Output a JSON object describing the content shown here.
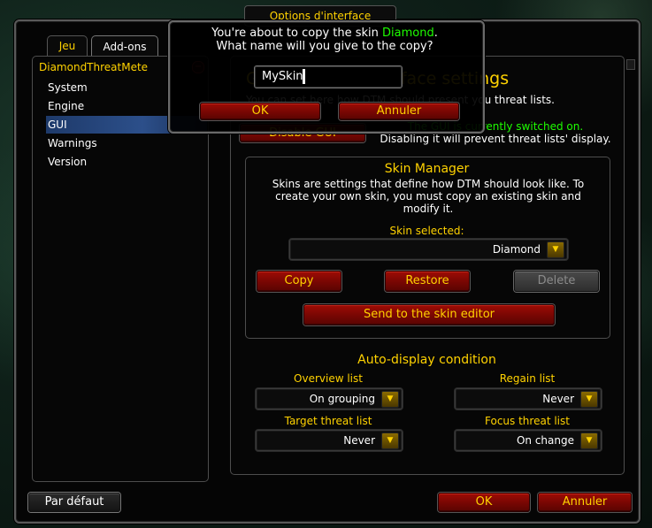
{
  "window": {
    "title": "Options d'interface",
    "tabs": [
      "Jeu",
      "Add-ons"
    ]
  },
  "sidebar": {
    "addon_name": "DiamondThreatMete",
    "items": [
      "System",
      "Engine",
      "GUI",
      "Warnings",
      "Version"
    ],
    "selected": "GUI"
  },
  "main": {
    "heading": "General User Interface settings",
    "description": "You can set here how DTM should present you threat lists.",
    "disable_gui_label": "Disable GUI",
    "gui_status": "The GUI is currently switched on.",
    "gui_hint": "Disabling it will prevent threat lists' display."
  },
  "skin_manager": {
    "title": "Skin Manager",
    "description": "Skins are settings that define how DTM should look like. To create your own skin, you must copy an existing skin and modify it.",
    "skin_selected_label": "Skin selected:",
    "skin_selected_value": "Diamond",
    "copy_label": "Copy",
    "restore_label": "Restore",
    "delete_label": "Delete",
    "send_label": "Send to the skin editor"
  },
  "auto_display": {
    "title": "Auto-display condition",
    "overview_label": "Overview list",
    "overview_value": "On grouping",
    "regain_label": "Regain list",
    "regain_value": "Never",
    "target_label": "Target threat list",
    "target_value": "Never",
    "focus_label": "Focus threat list",
    "focus_value": "On change"
  },
  "footer": {
    "defaults_label": "Par défaut",
    "ok_label": "OK",
    "cancel_label": "Annuler"
  },
  "popup": {
    "line1_prefix": "You're about to copy the skin ",
    "skin_name": "Diamond",
    "line1_suffix": ".",
    "line2": "What name will you give to the copy?",
    "input_value": "MySkin",
    "ok_label": "OK",
    "cancel_label": "Annuler"
  },
  "colors": {
    "gold": "#ffd200",
    "green": "#1eff00",
    "button_red": "#7a0703"
  }
}
